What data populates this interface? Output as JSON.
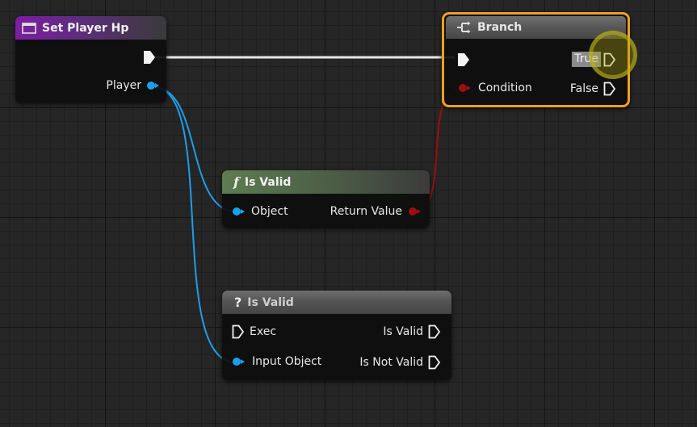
{
  "colors": {
    "exec_wire": "#e8e8e8",
    "object_wire": "#1e9ee8",
    "bool_wire": "#9c0f0f",
    "selection_outline": "#f0a020",
    "cursor_highlight": "#c8bf1e"
  },
  "nodes": {
    "set_player_hp": {
      "title": "Set Player Hp",
      "icon": "function-graph-icon",
      "pins": {
        "player": "Player"
      }
    },
    "branch": {
      "title": "Branch",
      "icon": "branch-icon",
      "selected": true,
      "pins": {
        "condition": "Condition",
        "true": "True",
        "false": "False"
      }
    },
    "is_valid_function": {
      "title": "Is Valid",
      "icon_glyph": "f",
      "pins": {
        "object": "Object",
        "return_value": "Return Value"
      }
    },
    "is_valid_macro": {
      "title": "Is Valid",
      "icon_glyph": "?",
      "pins": {
        "exec": "Exec",
        "input_object": "Input Object",
        "is_valid": "Is Valid",
        "is_not_valid": "Is Not Valid"
      }
    }
  }
}
